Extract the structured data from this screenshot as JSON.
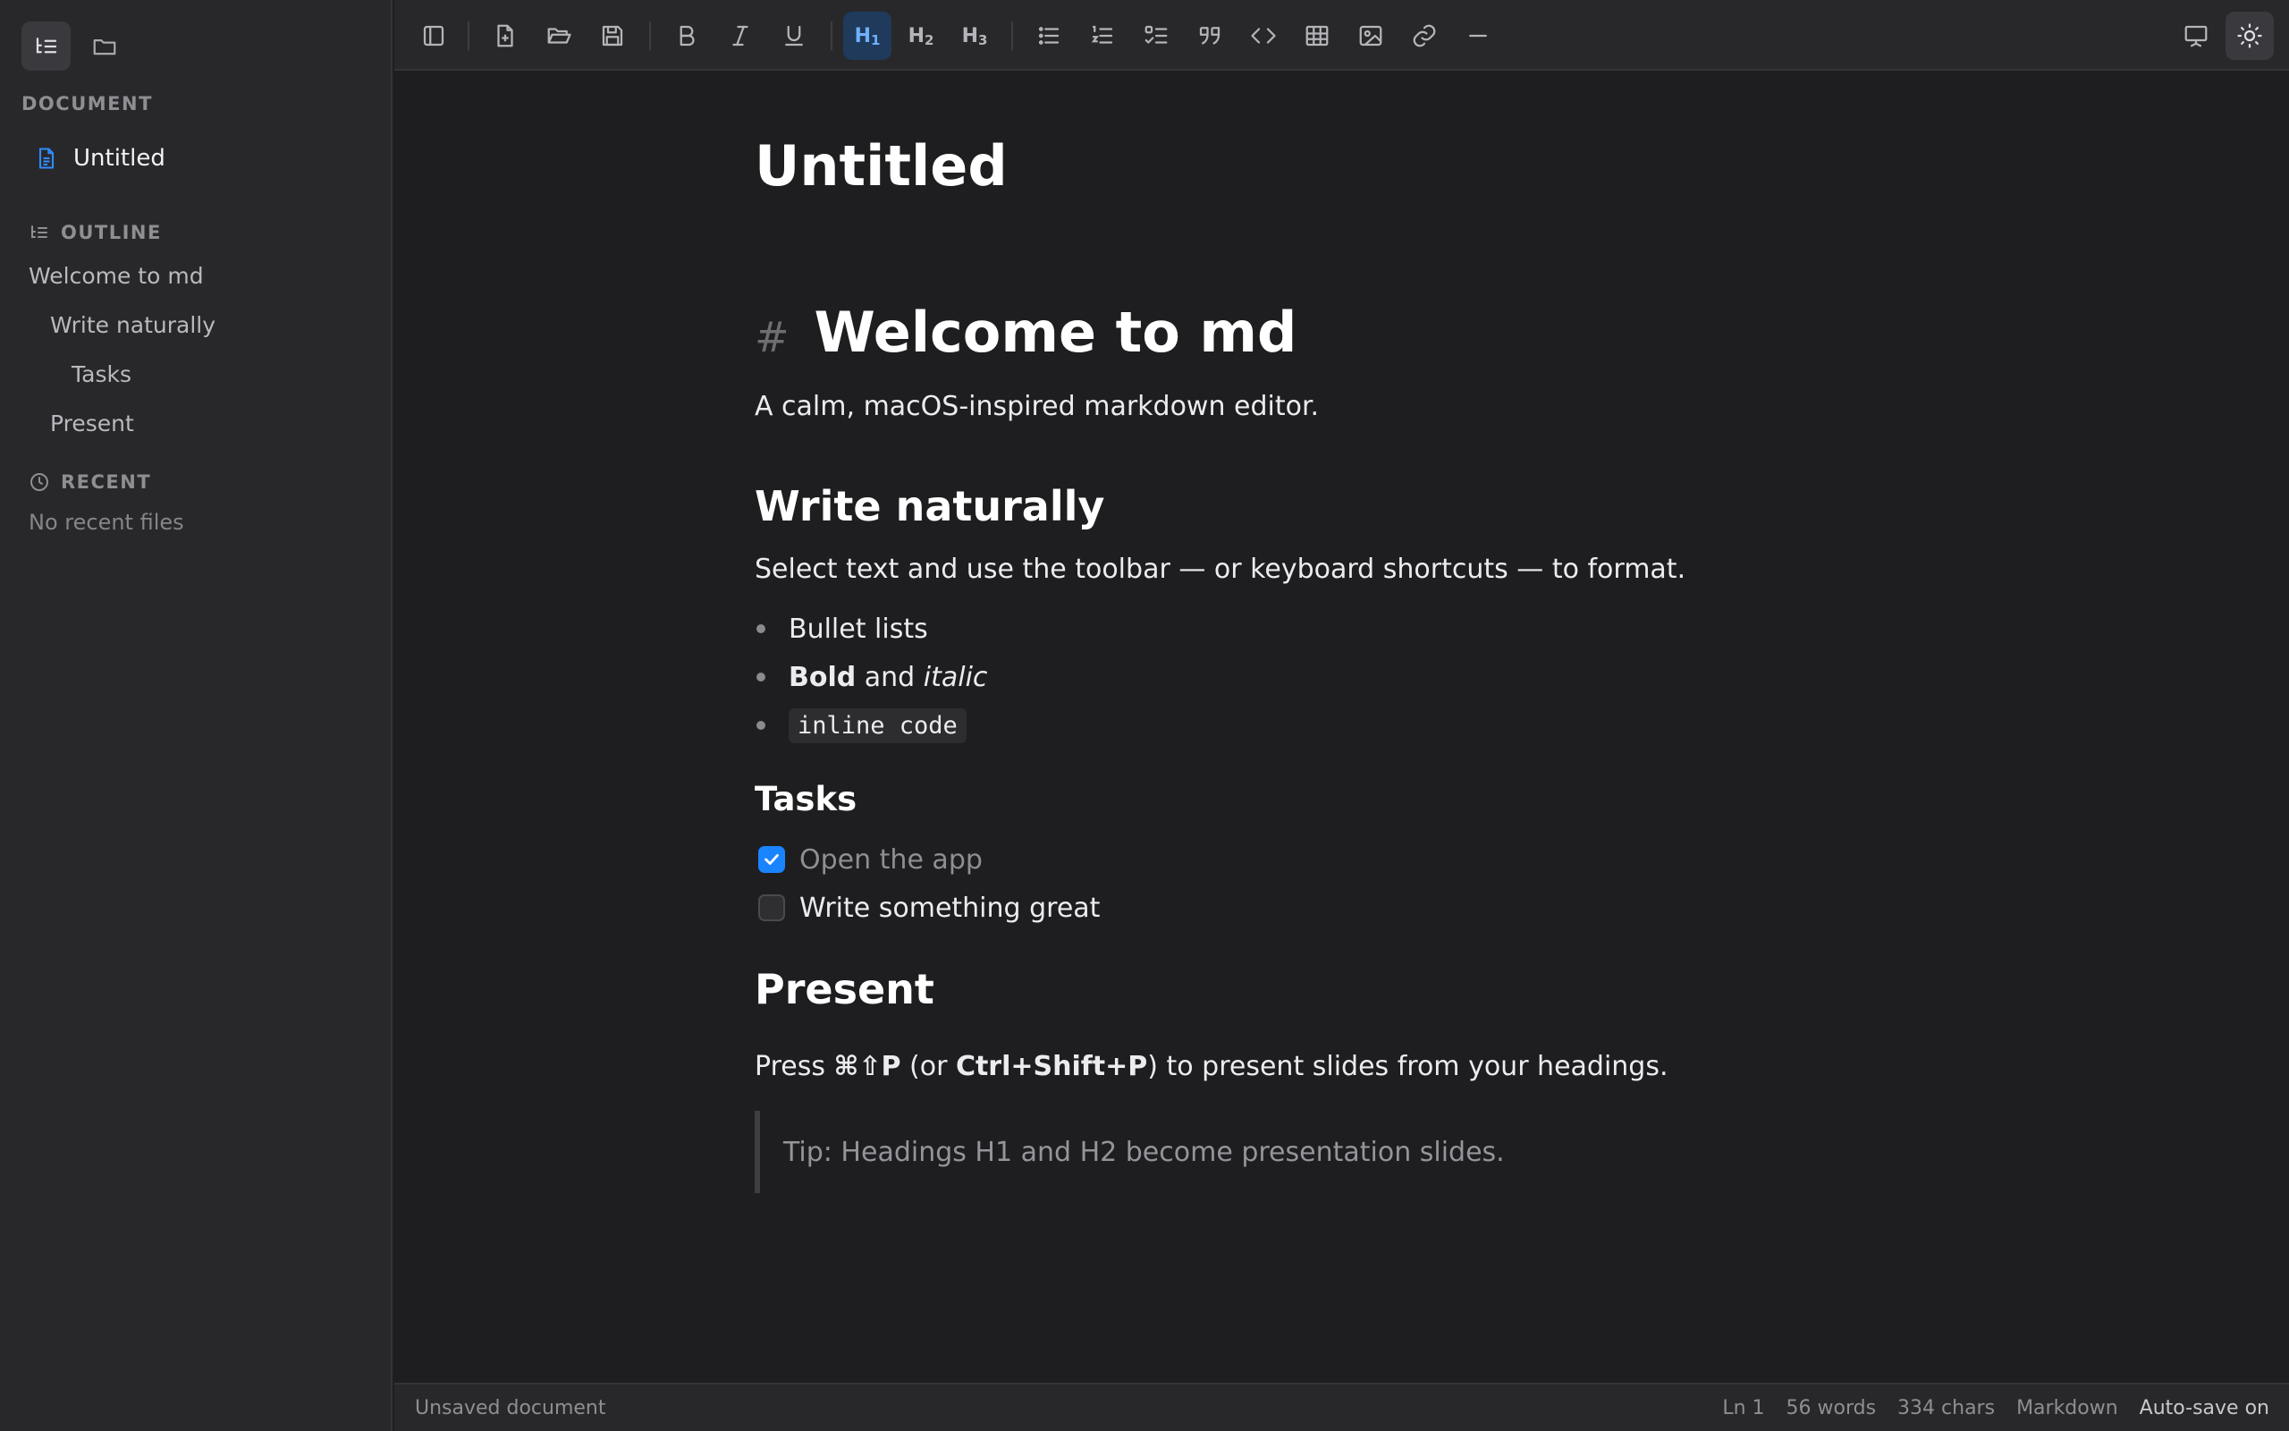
{
  "sidebar": {
    "document_heading": "DOCUMENT",
    "document_name": "Untitled",
    "outline_heading": "OUTLINE",
    "outline": [
      {
        "label": "Welcome to md",
        "level": 1
      },
      {
        "label": "Write naturally",
        "level": 2
      },
      {
        "label": "Tasks",
        "level": 3
      },
      {
        "label": "Present",
        "level": 2
      }
    ],
    "recent_heading": "RECENT",
    "recent_empty": "No recent files"
  },
  "toolbar": {
    "h1_label": "H",
    "h1_sub": "1",
    "h2_label": "H",
    "h2_sub": "2",
    "h3_label": "H",
    "h3_sub": "3",
    "active_heading": "h1"
  },
  "editor": {
    "doc_title": "Untitled",
    "h1_hash": "#",
    "h1": "Welcome to md",
    "intro": "A calm, macOS-inspired markdown editor.",
    "h2_write": "Write naturally",
    "write_para": "Select text and use the toolbar — or keyboard shortcuts — to format.",
    "bullets": {
      "b1": "Bullet lists",
      "b2_bold": "Bold",
      "b2_and": " and ",
      "b2_italic": "italic",
      "b3_code": "inline code"
    },
    "h3_tasks": "Tasks",
    "tasks": [
      {
        "label": "Open the app",
        "done": true
      },
      {
        "label": "Write something great",
        "done": false
      }
    ],
    "h2_present": "Present",
    "present": {
      "pre": "Press ",
      "shortcut_mac": "⌘⇧P",
      "mid": " (or ",
      "shortcut_win": "Ctrl+Shift+P",
      "post": ") to present slides from your headings."
    },
    "tip": "Tip: Headings H1 and H2 become presentation slides."
  },
  "statusbar": {
    "left": "Unsaved document",
    "line": "Ln 1",
    "words": "56 words",
    "chars": "334 chars",
    "mode": "Markdown",
    "autosave": "Auto-save on"
  },
  "colors": {
    "accent": "#1a84ff",
    "background": "#1e1e20",
    "panel": "#28282b"
  }
}
